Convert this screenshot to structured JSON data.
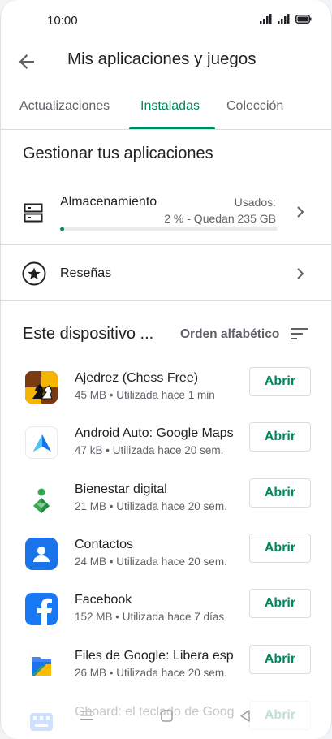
{
  "status_bar": {
    "time": "10:00"
  },
  "app_bar": {
    "title": "Mis aplicaciones y juegos",
    "back_icon": "arrow-back-icon"
  },
  "tabs": [
    {
      "label": "Actualizaciones",
      "active": false
    },
    {
      "label": "Instaladas",
      "active": true
    },
    {
      "label": "Colección",
      "active": false
    }
  ],
  "manage": {
    "title": "Gestionar tus aplicaciones",
    "storage": {
      "label": "Almacenamiento",
      "used_label": "Usados:",
      "detail": "2 % - Quedan 235 GB",
      "used_fraction": 0.02
    },
    "reviews": {
      "label": "Reseñas"
    }
  },
  "device": {
    "title": "Este dispositivo ...",
    "sort_label": "Orden alfabético"
  },
  "apps": [
    {
      "name": "Ajedrez (Chess Free)",
      "meta": "45 MB • Utilizada hace 1 min",
      "button": "Abrir",
      "icon": "chess-icon"
    },
    {
      "name": "Android Auto: Google Maps",
      "meta": "47 kB • Utilizada hace 20 sem.",
      "button": "Abrir",
      "icon": "android-auto-icon"
    },
    {
      "name": "Bienestar digital",
      "meta": "21 MB • Utilizada hace 20 sem.",
      "button": "Abrir",
      "icon": "digital-wellbeing-icon"
    },
    {
      "name": "Contactos",
      "meta": "24 MB • Utilizada hace 20 sem.",
      "button": "Abrir",
      "icon": "contacts-icon"
    },
    {
      "name": "Facebook",
      "meta": "152 MB • Utilizada hace 7 días",
      "button": "Abrir",
      "icon": "facebook-icon"
    },
    {
      "name": "Files de Google: Libera espacio",
      "meta": "26 MB • Utilizada hace 20 sem.",
      "button": "Abrir",
      "icon": "files-icon"
    },
    {
      "name": "Gboard: el teclado de Google",
      "meta": "",
      "button": "Abrir",
      "icon": "gboard-icon"
    }
  ],
  "colors": {
    "accent": "#01875f",
    "divider": "#dadce0",
    "text": "#202124",
    "secondary": "#5f6368"
  }
}
